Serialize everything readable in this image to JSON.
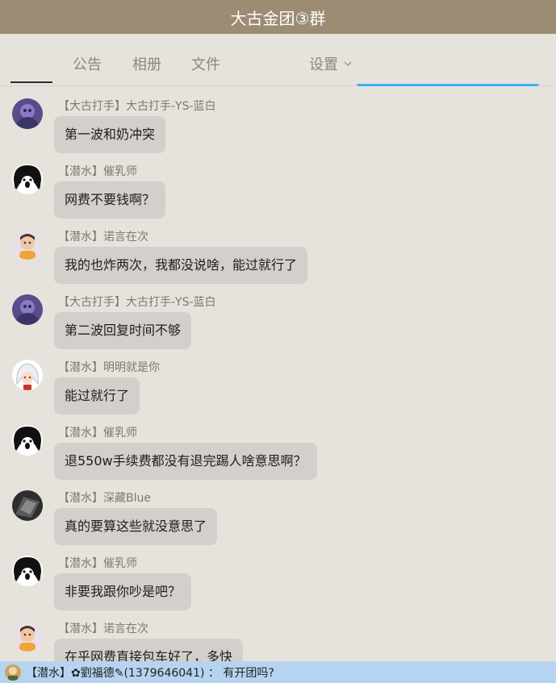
{
  "header": {
    "title": "大古金团③群"
  },
  "tabs": [
    {
      "label": ""
    },
    {
      "label": "公告"
    },
    {
      "label": "相册"
    },
    {
      "label": "文件"
    },
    {
      "label": "设置"
    }
  ],
  "messages": [
    {
      "sender": "【大古打手】大古打手-YS-蓝白",
      "text": "第一波和奶冲突",
      "avatar": "purple-avatar-icon"
    },
    {
      "sender": "【潜水】催乳师",
      "text": "网费不要钱啊？",
      "avatar": "black-hair-avatar-icon"
    },
    {
      "sender": "【潜水】诺言在次",
      "text": "我的也炸两次，我都没说啥，能过就行了",
      "avatar": "child-avatar-icon"
    },
    {
      "sender": "【大古打手】大古打手-YS-蓝白",
      "text": "第二波回复时间不够",
      "avatar": "purple-avatar-icon"
    },
    {
      "sender": "【潜水】明明就是你",
      "text": "能过就行了",
      "avatar": "white-hair-avatar-icon"
    },
    {
      "sender": "【潜水】催乳师",
      "text": "退550w手续费都没有退完踢人啥意思啊？",
      "avatar": "black-hair-avatar-icon"
    },
    {
      "sender": "【潜水】深藏Blue",
      "text": "真的要算这些就没意思了",
      "avatar": "dark-avatar-icon"
    },
    {
      "sender": "【潜水】催乳师",
      "text": "非要我跟你吵是吧？",
      "avatar": "black-hair-avatar-icon"
    },
    {
      "sender": "【潜水】诺言在次",
      "text": "在乎网费直接包车好了，多快",
      "avatar": "child-avatar-icon"
    }
  ],
  "notification": {
    "text": "【潜水】✿劉福德✎(1379646041) ： 有开团吗?"
  },
  "colors": {
    "titlebar": "#9c8c73",
    "background": "#e6e3dd",
    "bubble": "#d3cfca",
    "accent_blue": "#3ab0ef",
    "notification_bar": "#b6d4f0"
  }
}
